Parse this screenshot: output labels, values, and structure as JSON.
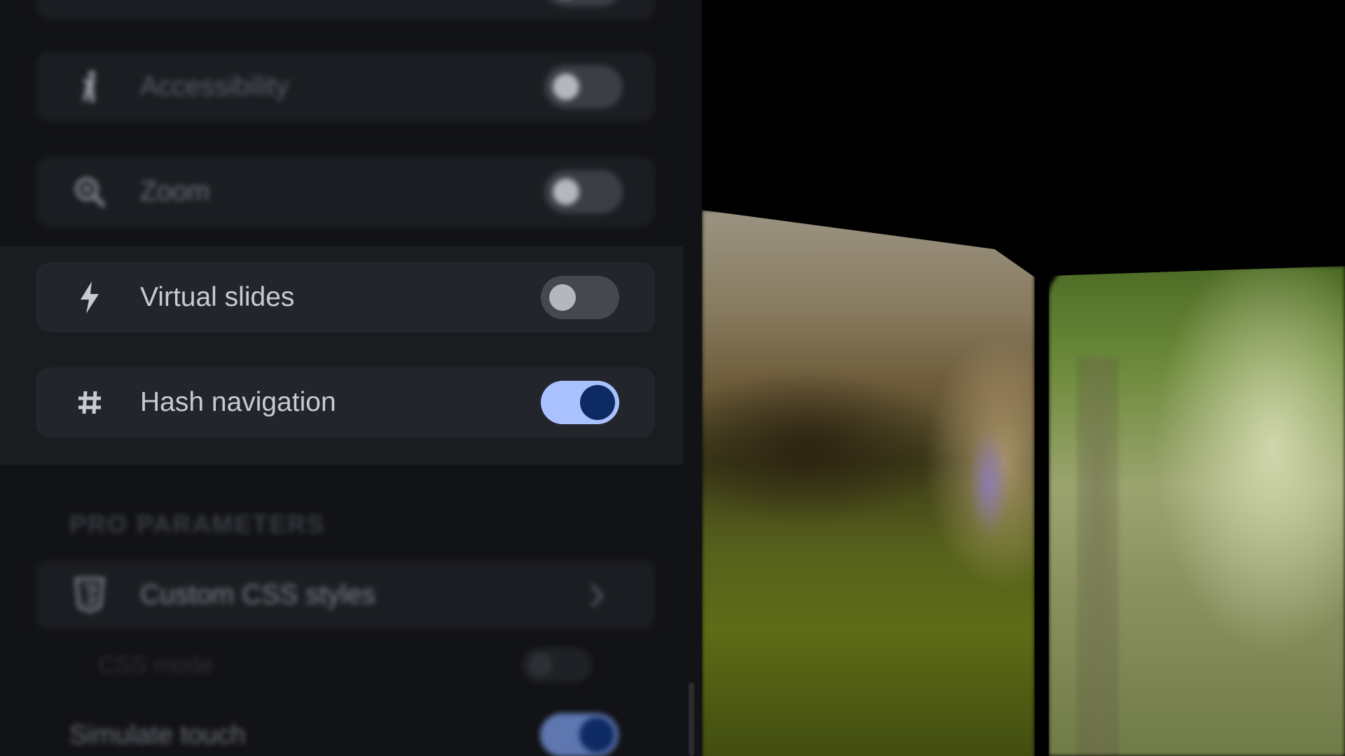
{
  "settings": {
    "top_row": {
      "label": ""
    },
    "accessibility": {
      "label": "Accessibility",
      "enabled": false,
      "icon": "accessibility-icon"
    },
    "zoom": {
      "label": "Zoom",
      "enabled": false,
      "icon": "zoom-icon"
    },
    "virtual_slides": {
      "label": "Virtual slides",
      "enabled": false,
      "icon": "lightning-icon"
    },
    "hash_navigation": {
      "label": "Hash navigation",
      "enabled": true,
      "icon": "hash-icon"
    }
  },
  "pro_parameters": {
    "title": "PRO PARAMETERS",
    "custom_css": {
      "label": "Custom CSS styles",
      "icon": "css3-icon"
    },
    "css_mode": {
      "label": "CSS mode",
      "enabled": false
    },
    "simulate_touch": {
      "label": "Simulate touch",
      "enabled": true
    }
  },
  "colors": {
    "panel_bg": "#121317",
    "row_bg": "#1b1d22",
    "toggle_on_track": "#a9c1ff",
    "toggle_on_knob": "#0e2a63",
    "toggle_off_track": "#3b3e45"
  }
}
